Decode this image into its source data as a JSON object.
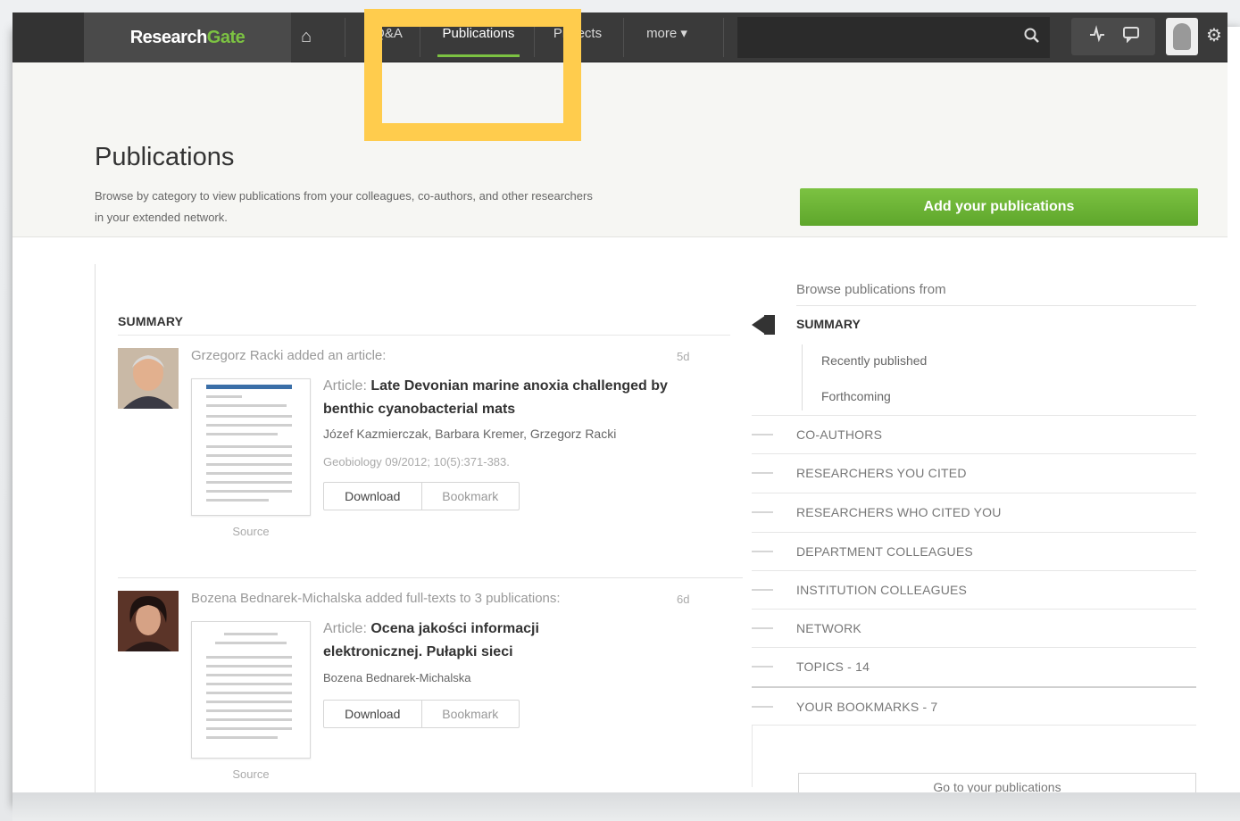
{
  "nav": {
    "logo_research": "Research",
    "logo_gate": "Gate",
    "items": [
      {
        "label": "Q&A"
      },
      {
        "label": "Publications"
      },
      {
        "label": "Projects"
      },
      {
        "label": "more ▾"
      }
    ],
    "active": "Publications"
  },
  "header": {
    "title": "Publications",
    "description": "Browse by category to view publications from your colleagues, co-authors, and other researchers in your extended network.",
    "add_button": "Add your publications"
  },
  "feed": {
    "heading": "SUMMARY",
    "items": [
      {
        "actor": "Grzegorz Racki added an article:",
        "time": "5d",
        "article_label": "Article:",
        "title": "Late Devonian marine anoxia challenged by benthic cyanobacterial mats",
        "authors": "Józef Kazmierczak, Barbara Kremer, Grzegorz Racki",
        "journal": "Geobiology 09/2012; 10(5):371-383.",
        "download": "Download",
        "bookmark": "Bookmark",
        "source": "Source"
      },
      {
        "actor": "Bozena Bednarek-Michalska added full-texts to 3 publications:",
        "time": "6d",
        "article_label": "Article:",
        "title": "Ocena jakości informacji elektronicznej. Pułapki sieci",
        "authors": "Bozena Bednarek-Michalska",
        "download": "Download",
        "bookmark": "Bookmark",
        "source": "Source"
      }
    ]
  },
  "sidebar": {
    "browse_label": "Browse publications from",
    "summary": "SUMMARY",
    "sub_items": [
      "Recently published",
      "Forthcoming"
    ],
    "items": [
      "CO-AUTHORS",
      "RESEARCHERS YOU CITED",
      "RESEARCHERS WHO CITED YOU",
      "DEPARTMENT COLLEAGUES",
      "INSTITUTION COLLEAGUES",
      "NETWORK",
      "TOPICS - 14",
      "YOUR BOOKMARKS - 7"
    ],
    "go_button": "Go to your publications"
  },
  "colors": {
    "brand_green": "#7cc242",
    "nav_dark": "#3a3a3a",
    "highlight": "#ffcc4d"
  },
  "icons": [
    "home-icon",
    "search-icon",
    "activity-icon",
    "message-icon",
    "gear-icon"
  ]
}
